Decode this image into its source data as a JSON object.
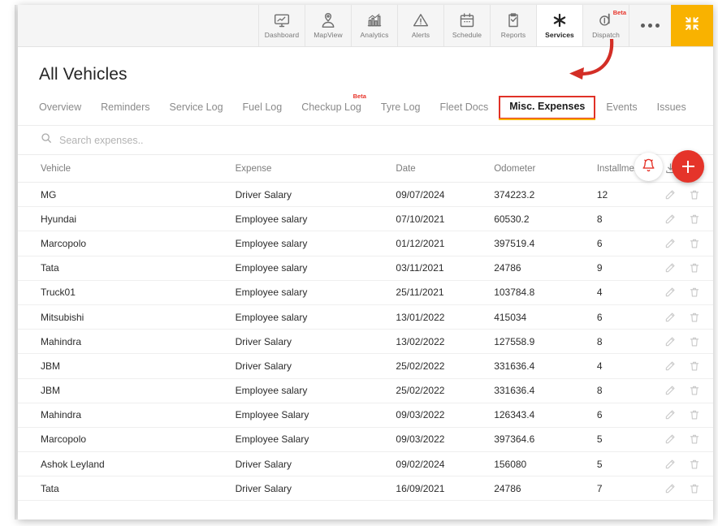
{
  "topnav": {
    "items": [
      {
        "label": "Dashboard",
        "icon": "dashboard-monitor-icon",
        "active": false,
        "badge": ""
      },
      {
        "label": "MapView",
        "icon": "map-pin-icon",
        "active": false,
        "badge": ""
      },
      {
        "label": "Analytics",
        "icon": "bar-chart-icon",
        "active": false,
        "badge": ""
      },
      {
        "label": "Alerts",
        "icon": "warning-triangle-icon",
        "active": false,
        "badge": ""
      },
      {
        "label": "Schedule",
        "icon": "calendar-icon",
        "active": false,
        "badge": ""
      },
      {
        "label": "Reports",
        "icon": "clipboard-check-icon",
        "active": false,
        "badge": ""
      },
      {
        "label": "Services",
        "icon": "asterisk-wrench-icon",
        "active": true,
        "badge": ""
      },
      {
        "label": "Dispatch",
        "icon": "dispatch-icon",
        "active": false,
        "badge": "Beta"
      }
    ],
    "more_icon": "ellipsis-icon",
    "collapse_icon": "collapse-arrows-icon",
    "accent_orange": "#f9b200"
  },
  "page": {
    "title": "All Vehicles"
  },
  "tabs": [
    {
      "label": "Overview",
      "active": false,
      "badge": ""
    },
    {
      "label": "Reminders",
      "active": false,
      "badge": ""
    },
    {
      "label": "Service Log",
      "active": false,
      "badge": ""
    },
    {
      "label": "Fuel Log",
      "active": false,
      "badge": ""
    },
    {
      "label": "Checkup Log",
      "active": false,
      "badge": "Beta"
    },
    {
      "label": "Tyre Log",
      "active": false,
      "badge": ""
    },
    {
      "label": "Fleet Docs",
      "active": false,
      "badge": ""
    },
    {
      "label": "Misc. Expenses",
      "active": true,
      "badge": ""
    },
    {
      "label": "Events",
      "active": false,
      "badge": ""
    },
    {
      "label": "Issues",
      "active": false,
      "badge": ""
    }
  ],
  "actions": {
    "bell_icon": "bell-icon",
    "add_icon": "plus-icon",
    "add_color": "#e5342a"
  },
  "search": {
    "placeholder": "Search expenses..",
    "value": "",
    "icon": "search-icon"
  },
  "table": {
    "download_icon": "download-icon",
    "edit_icon": "pencil-icon",
    "delete_icon": "trash-icon",
    "columns": [
      "Vehicle",
      "Expense",
      "Date",
      "Odometer",
      "Installment"
    ],
    "rows": [
      {
        "vehicle": "MG",
        "expense": "Driver Salary",
        "date": "09/07/2024",
        "odometer": "374223.2",
        "installment": "12"
      },
      {
        "vehicle": "Hyundai",
        "expense": "Employee salary",
        "date": "07/10/2021",
        "odometer": "60530.2",
        "installment": "8"
      },
      {
        "vehicle": "Marcopolo",
        "expense": "Employee salary",
        "date": "01/12/2021",
        "odometer": "397519.4",
        "installment": "6"
      },
      {
        "vehicle": "Tata",
        "expense": "Employee salary",
        "date": "03/11/2021",
        "odometer": "24786",
        "installment": "9"
      },
      {
        "vehicle": "Truck01",
        "expense": "Employee salary",
        "date": "25/11/2021",
        "odometer": "103784.8",
        "installment": "4"
      },
      {
        "vehicle": "Mitsubishi",
        "expense": "Employee salary",
        "date": "13/01/2022",
        "odometer": "415034",
        "installment": "6"
      },
      {
        "vehicle": "Mahindra",
        "expense": "Driver Salary",
        "date": "13/02/2022",
        "odometer": "127558.9",
        "installment": "8"
      },
      {
        "vehicle": "JBM",
        "expense": "Driver Salary",
        "date": "25/02/2022",
        "odometer": "331636.4",
        "installment": "4"
      },
      {
        "vehicle": "JBM",
        "expense": "Employee salary",
        "date": "25/02/2022",
        "odometer": "331636.4",
        "installment": "8"
      },
      {
        "vehicle": "Mahindra",
        "expense": "Employee Salary",
        "date": "09/03/2022",
        "odometer": "126343.4",
        "installment": "6"
      },
      {
        "vehicle": "Marcopolo",
        "expense": "Employee Salary",
        "date": "09/03/2022",
        "odometer": "397364.6",
        "installment": "5"
      },
      {
        "vehicle": "Ashok Leyland",
        "expense": "Driver Salary",
        "date": "09/02/2024",
        "odometer": "156080",
        "installment": "5"
      },
      {
        "vehicle": "Tata",
        "expense": "Driver Salary",
        "date": "16/09/2021",
        "odometer": "24786",
        "installment": "7"
      }
    ]
  },
  "annotation": {
    "type": "curved-arrow",
    "color": "#d32e26",
    "points_to": "Services"
  }
}
